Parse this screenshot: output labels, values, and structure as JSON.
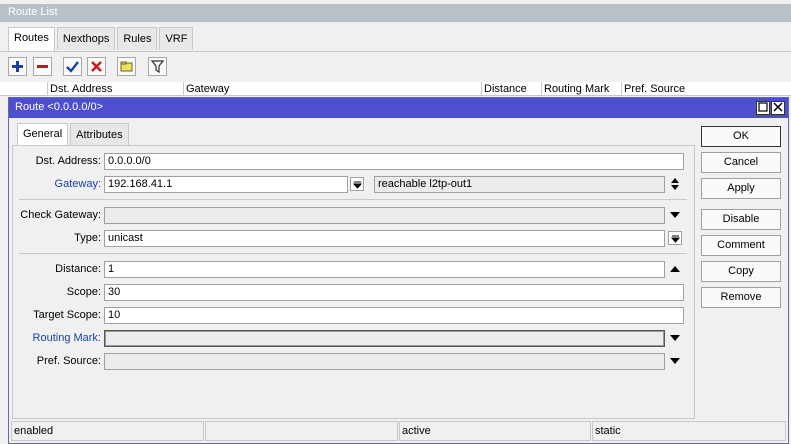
{
  "route_list": {
    "title": "Route List",
    "tabs": [
      "Routes",
      "Nexthops",
      "Rules",
      "VRF"
    ],
    "columns": [
      "Dst. Address",
      "Gateway",
      "Distance",
      "Routing Mark",
      "Pref. Source"
    ]
  },
  "dialog": {
    "title": "Route <0.0.0.0/0>",
    "tabs": [
      "General",
      "Attributes"
    ],
    "fields": {
      "dst_address": {
        "label": "Dst. Address:",
        "value": "0.0.0.0/0"
      },
      "gateway": {
        "label": "Gateway:",
        "value": "192.168.41.1",
        "state": "reachable l2tp-out1"
      },
      "check_gateway": {
        "label": "Check Gateway:",
        "value": ""
      },
      "type": {
        "label": "Type:",
        "value": "unicast"
      },
      "distance": {
        "label": "Distance:",
        "value": "1"
      },
      "scope": {
        "label": "Scope:",
        "value": "30"
      },
      "target_scope": {
        "label": "Target Scope:",
        "value": "10"
      },
      "routing_mark": {
        "label": "Routing Mark:",
        "value": ""
      },
      "pref_source": {
        "label": "Pref. Source:",
        "value": ""
      }
    },
    "buttons": {
      "ok": "OK",
      "cancel": "Cancel",
      "apply": "Apply",
      "disable": "Disable",
      "comment": "Comment",
      "copy": "Copy",
      "remove": "Remove"
    },
    "status": [
      "enabled",
      "",
      "active",
      "static"
    ]
  },
  "colors": {
    "title_bar": "#4e4ed0",
    "link_label": "#1a3fb0",
    "add_icon": "#1c3fa8",
    "remove_icon": "#b02020",
    "check_icon": "#1c3fa8",
    "cross_icon": "#c02020",
    "note_icon": "#f0e060"
  }
}
